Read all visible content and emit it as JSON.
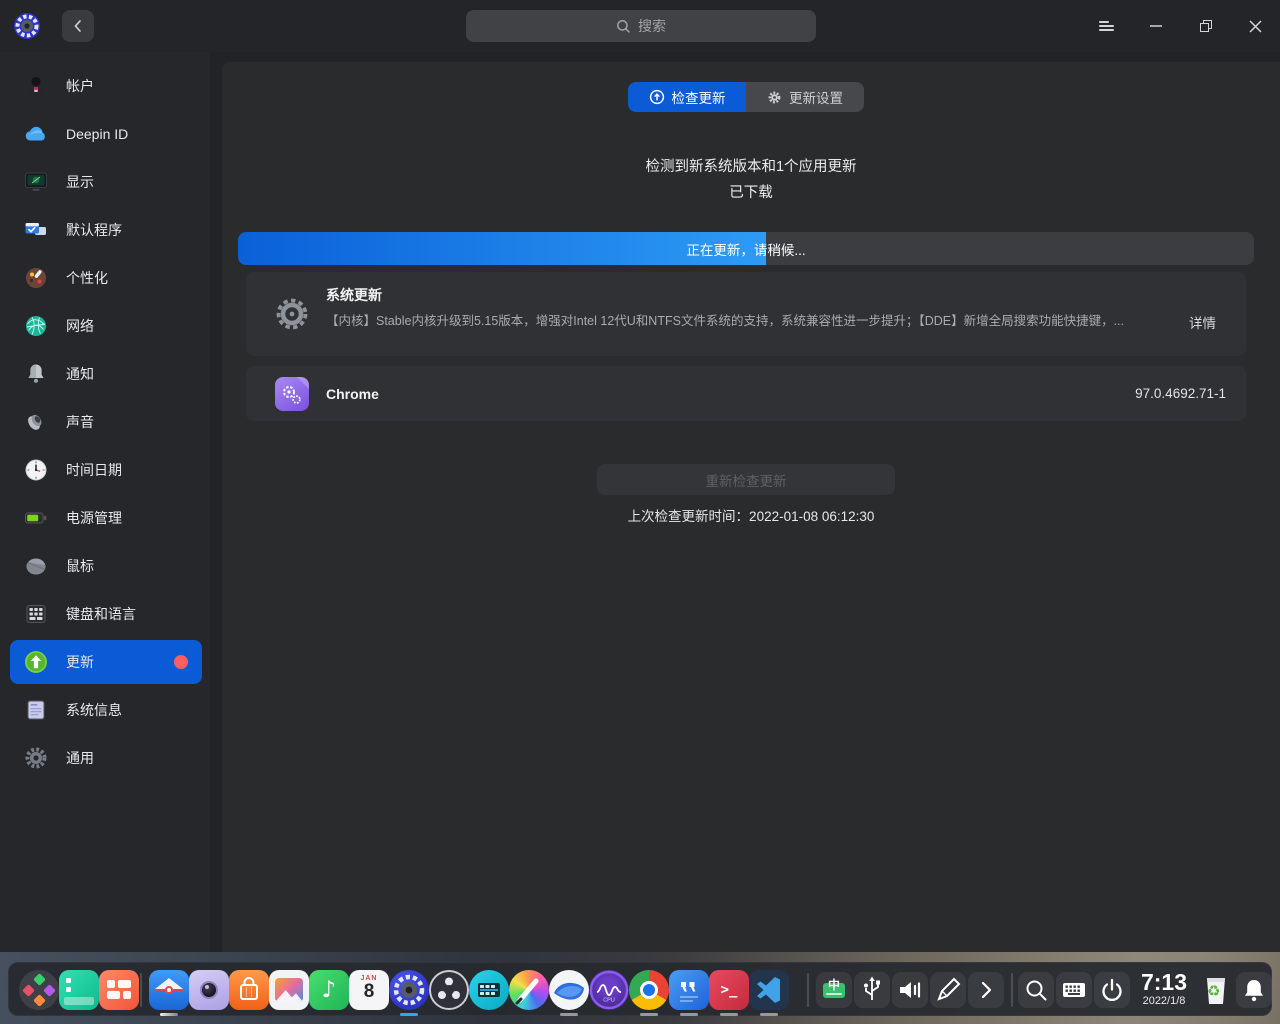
{
  "colors": {
    "accent_blue": "#0b5bd7",
    "progress_gradient": [
      "#0a60d8",
      "#2d9bf5"
    ],
    "sidebar_selected_bg": "#0b5bd7",
    "badge_red": "#fc5f5f",
    "dock_active_indicator": "#2ca7f8",
    "panel_bg": "#2a2b2d",
    "window_bg": "#222326"
  },
  "titlebar": {
    "search_placeholder": "搜索",
    "icons": [
      "settings-logo-icon",
      "back-icon",
      "search-icon",
      "menu-icon",
      "minimize-icon",
      "restore-icon",
      "close-icon"
    ]
  },
  "sidebar": {
    "items": [
      {
        "label": "帐户",
        "icon": "user-icon",
        "selected": false
      },
      {
        "label": "Deepin ID",
        "icon": "cloud-icon",
        "selected": false
      },
      {
        "label": "显示",
        "icon": "display-icon",
        "selected": false
      },
      {
        "label": "默认程序",
        "icon": "default-apps-icon",
        "selected": false
      },
      {
        "label": "个性化",
        "icon": "personalization-icon",
        "selected": false
      },
      {
        "label": "网络",
        "icon": "network-globe-icon",
        "selected": false
      },
      {
        "label": "通知",
        "icon": "bell-icon",
        "selected": false
      },
      {
        "label": "声音",
        "icon": "speaker-icon",
        "selected": false
      },
      {
        "label": "时间日期",
        "icon": "clock-icon",
        "selected": false
      },
      {
        "label": "电源管理",
        "icon": "battery-icon",
        "selected": false
      },
      {
        "label": "鼠标",
        "icon": "mouse-icon",
        "selected": false
      },
      {
        "label": "键盘和语言",
        "icon": "keyboard-icon",
        "selected": false
      },
      {
        "label": "更新",
        "icon": "update-arrow-icon",
        "selected": true,
        "badge": true
      },
      {
        "label": "系统信息",
        "icon": "system-info-icon",
        "selected": false
      },
      {
        "label": "通用",
        "icon": "gear-icon",
        "selected": false
      }
    ]
  },
  "main": {
    "tabs": [
      {
        "label": "检查更新",
        "icon": "arrow-up-circle-icon",
        "active": true
      },
      {
        "label": "更新设置",
        "icon": "gear-icon",
        "active": false
      }
    ],
    "status_line1": "检测到新系统版本和1个应用更新",
    "status_line2": "已下载",
    "progress": {
      "label": "正在更新，请稍候...",
      "percent": 52
    },
    "updates": [
      {
        "name": "系统更新",
        "icon": "gear-icon",
        "description": "【内核】Stable内核升级到5.15版本，增强对Intel 12代U和NTFS文件系统的支持，系统兼容性进一步提升；【DDE】新增全局搜索功能快捷键，...",
        "action": "详情"
      },
      {
        "name": "Chrome",
        "icon": "package-icon",
        "version": "97.0.4692.71-1"
      }
    ],
    "recheck_button": "重新检查更新",
    "last_check": "上次检查更新时间：2022-01-08 06:12:30"
  },
  "dock": {
    "apps": [
      "launcher",
      "show-desktop",
      "multitasking-view",
      "file-manager",
      "camera",
      "app-store",
      "image-viewer",
      "music",
      "calendar",
      "control-center",
      "obs",
      "movie-editor",
      "krita",
      "browser",
      "system-monitor",
      "chrome",
      "text-editor",
      "terminal",
      "vscode"
    ],
    "calendar": {
      "month": "JAN",
      "day": "8"
    },
    "ime_label": "中",
    "terminal_glyph": ">_",
    "music_glyph": "♪",
    "recycle_glyph": "♻",
    "tray": [
      "input-method",
      "usb",
      "volume",
      "screenshot",
      "expand",
      "search",
      "onscreen-keyboard",
      "power",
      "trash",
      "notification-bell"
    ],
    "clock": {
      "time": "7:13",
      "date": "2022/1/8"
    }
  }
}
